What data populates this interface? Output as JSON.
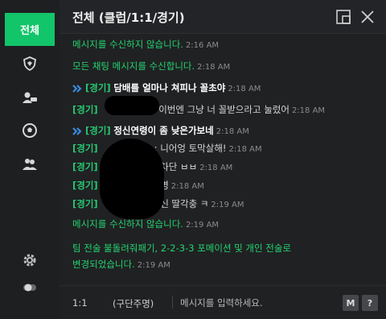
{
  "sidebar": {
    "active_tab": "전체",
    "icons": [
      "shield-icon",
      "friend-chat-icon",
      "ball-icon",
      "group-icon",
      "gear-icon",
      "toggle-icon"
    ]
  },
  "header": {
    "title": "전체 (클럽/1:1/경기)",
    "buttons": [
      "minimize-window-icon",
      "close-icon"
    ]
  },
  "colors": {
    "accent": "#12c46a",
    "system_text": "#22d46f",
    "tag": "#26c770",
    "background": "#202123"
  },
  "messages": [
    {
      "kind": "system",
      "text": "메시지를 수신하지 않습니다.",
      "time": "2:16 AM"
    },
    {
      "kind": "system",
      "text": "모든 채팅 메시지를 수신합니다.",
      "time": "2:18 AM"
    },
    {
      "kind": "shout",
      "tag": "[경기]",
      "text": "담배를 얼마나 쳐피나 꼴초야",
      "time": "2:18 AM"
    },
    {
      "kind": "chat",
      "tag": "[경기]",
      "text": ": 이번엔 그냥 너 꼴받으라고 눌렀어",
      "time": "2:18 AM"
    },
    {
      "kind": "shout",
      "tag": "[경기]",
      "text": "정신연령이 좀 낮은가보네",
      "time": "2:18 AM"
    },
    {
      "kind": "chat",
      "tag": "[경기]",
      "text": ": 니어엉 토막살해!",
      "time": "2:18 AM"
    },
    {
      "kind": "chat",
      "tag": "[경기]",
      "text": ": 차단 ㅂㅂ",
      "time": "2:18 AM"
    },
    {
      "kind": "chat",
      "tag": "[경기]",
      "text": ": 병",
      "time": "2:18 AM"
    },
    {
      "kind": "chat",
      "tag": "[경기]",
      "text": ": 신 딸각충 ㅋ",
      "time": "2:19 AM"
    },
    {
      "kind": "system",
      "text": "메시지를 수신하지 않습니다.",
      "time": "2:19 AM"
    },
    {
      "kind": "system",
      "text": "팀 전술 불돌려줘패기, 2-2-3-3 포메이션 및 개인 전술로",
      "time": ""
    },
    {
      "kind": "system",
      "text": "변경되었습니다.",
      "time": "2:19 AM"
    }
  ],
  "input": {
    "channel": "1:1",
    "scope": "(구단주명)",
    "placeholder": "메시지를 입력하세요.",
    "macro_label": "M",
    "help_label": "?"
  }
}
